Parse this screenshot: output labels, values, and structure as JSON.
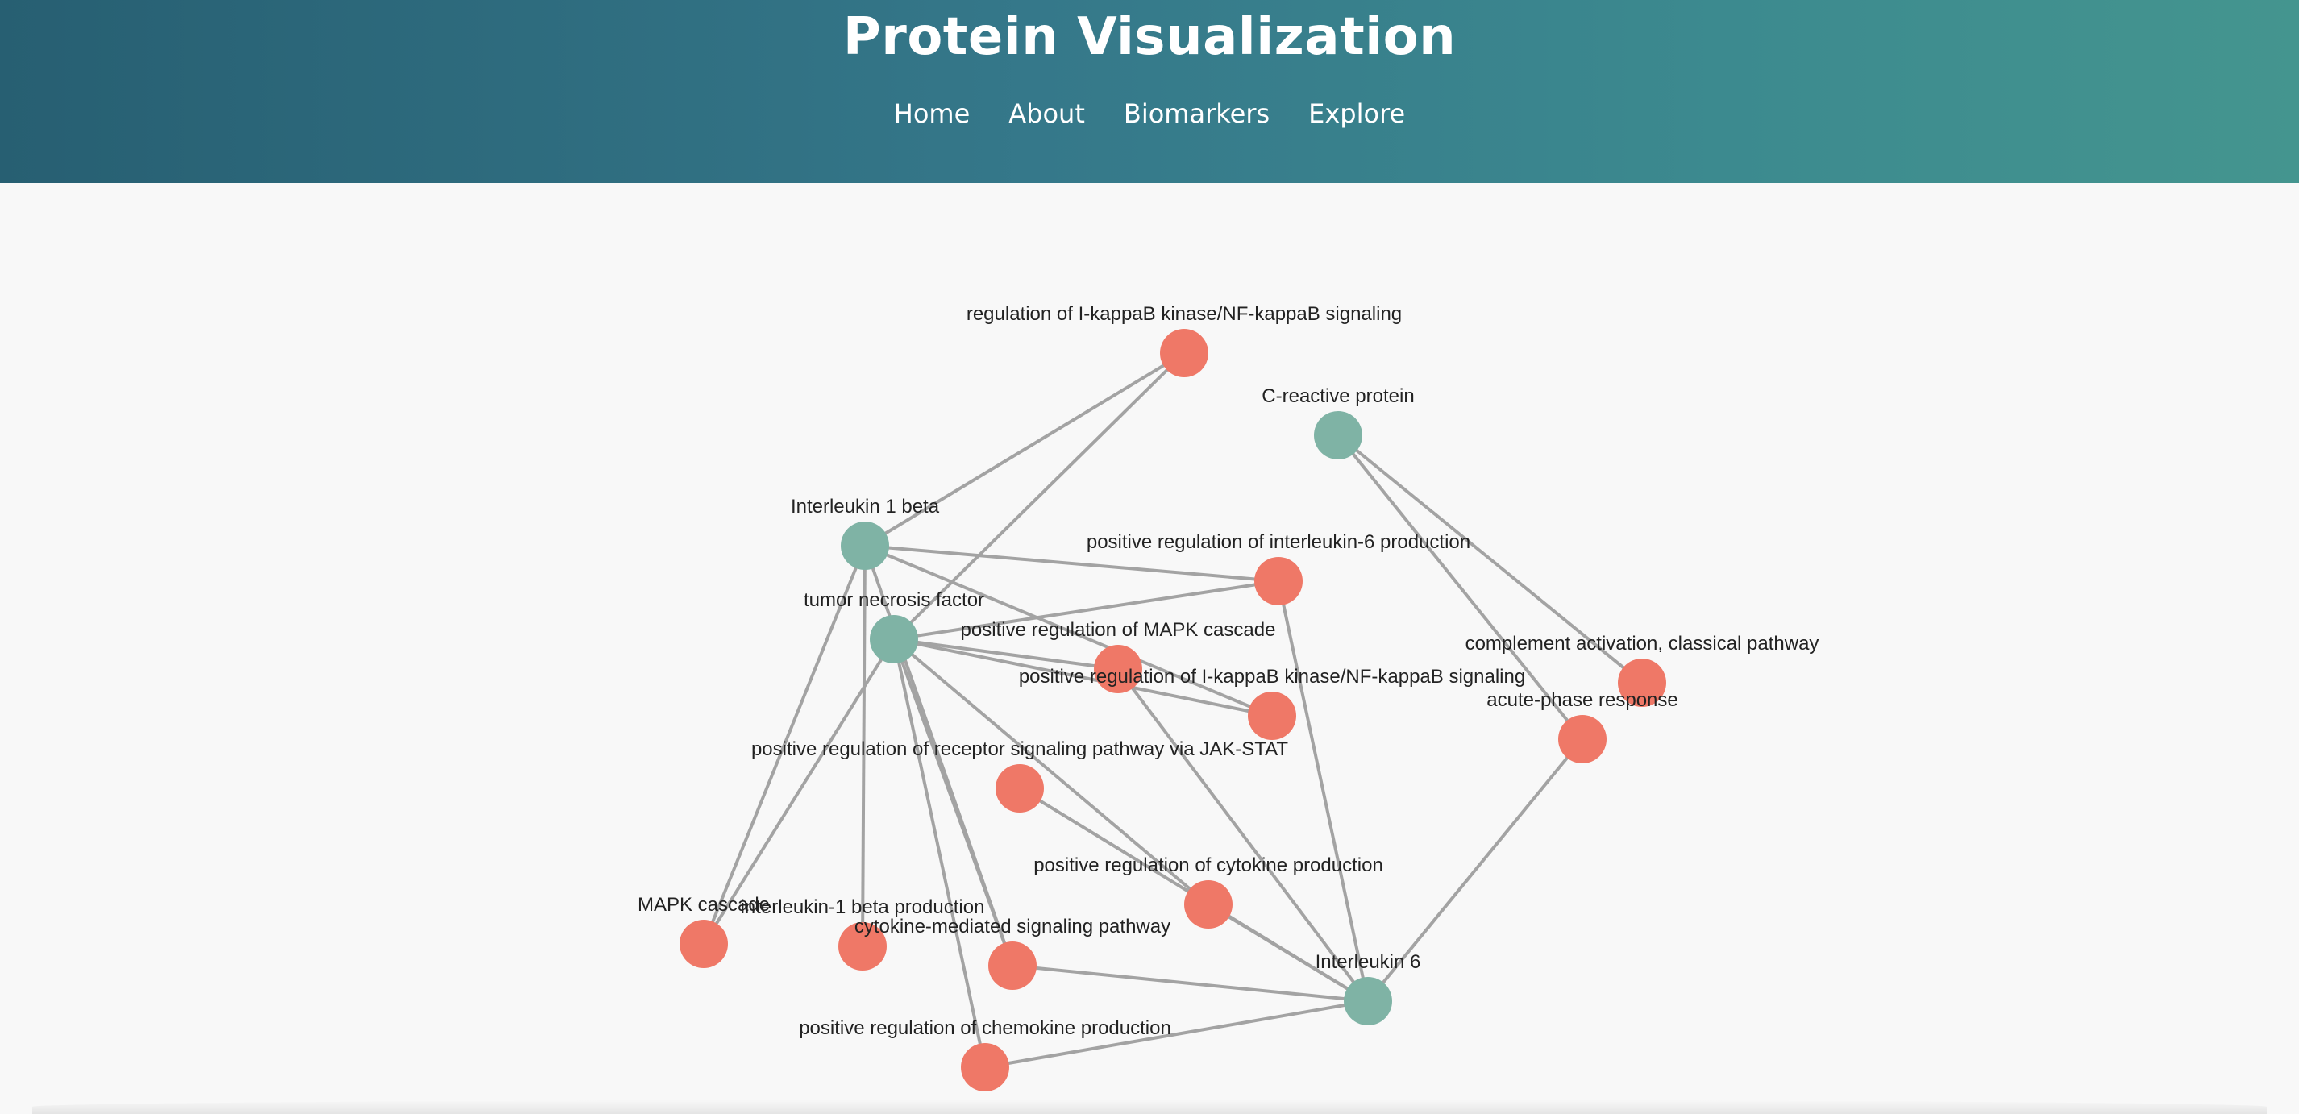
{
  "header": {
    "title": "Protein Visualization",
    "nav": [
      "Home",
      "About",
      "Biomarkers",
      "Explore"
    ]
  },
  "colors": {
    "header_gradient_start": "#275f72",
    "header_gradient_end": "#44958f",
    "protein_node": "#7fb3a5",
    "process_node": "#ef7867",
    "edge": "#a3a3a3",
    "background": "#f8f8f8"
  },
  "network": {
    "nodes": [
      {
        "id": "regulation-ikb",
        "label": "regulation of I-kappaB kinase/NF-kappaB signaling",
        "type": "process"
      },
      {
        "id": "crp",
        "label": "C-reactive protein",
        "type": "protein"
      },
      {
        "id": "il1b",
        "label": "Interleukin 1 beta",
        "type": "protein"
      },
      {
        "id": "pos-reg-il6",
        "label": "positive regulation of interleukin-6 production",
        "type": "process"
      },
      {
        "id": "tnf",
        "label": "tumor necrosis factor",
        "type": "protein"
      },
      {
        "id": "pos-reg-mapk",
        "label": "positive regulation of MAPK cascade",
        "type": "process"
      },
      {
        "id": "complement",
        "label": "complement activation, classical pathway",
        "type": "process"
      },
      {
        "id": "pos-reg-ikb",
        "label": "positive regulation of I-kappaB kinase/NF-kappaB signaling",
        "type": "process"
      },
      {
        "id": "acute-phase",
        "label": "acute-phase response",
        "type": "process"
      },
      {
        "id": "jak-stat",
        "label": "positive regulation of receptor signaling pathway via JAK-STAT",
        "type": "process"
      },
      {
        "id": "cytokine-prod",
        "label": "positive regulation of cytokine production",
        "type": "process"
      },
      {
        "id": "mapk",
        "label": "MAPK cascade",
        "type": "process"
      },
      {
        "id": "il1b-prod",
        "label": "interleukin-1 beta production",
        "type": "process"
      },
      {
        "id": "cytokine-signal",
        "label": "cytokine-mediated signaling pathway",
        "type": "process"
      },
      {
        "id": "il6",
        "label": "Interleukin 6",
        "type": "protein"
      },
      {
        "id": "chemokine",
        "label": "positive regulation of chemokine production",
        "type": "process"
      }
    ],
    "edges": [
      [
        "il1b",
        "regulation-ikb"
      ],
      [
        "tnf",
        "regulation-ikb"
      ],
      [
        "il1b",
        "pos-reg-il6"
      ],
      [
        "tnf",
        "pos-reg-il6"
      ],
      [
        "il6",
        "pos-reg-il6"
      ],
      [
        "il1b",
        "pos-reg-ikb"
      ],
      [
        "tnf",
        "pos-reg-ikb"
      ],
      [
        "tnf",
        "pos-reg-mapk"
      ],
      [
        "il6",
        "pos-reg-mapk"
      ],
      [
        "il1b",
        "mapk"
      ],
      [
        "tnf",
        "mapk"
      ],
      [
        "il1b",
        "il1b-prod"
      ],
      [
        "il1b",
        "cytokine-signal"
      ],
      [
        "tnf",
        "cytokine-signal"
      ],
      [
        "il6",
        "cytokine-signal"
      ],
      [
        "tnf",
        "chemokine"
      ],
      [
        "il6",
        "chemokine"
      ],
      [
        "tnf",
        "cytokine-prod"
      ],
      [
        "il6",
        "cytokine-prod"
      ],
      [
        "jak-stat",
        "il6"
      ],
      [
        "crp",
        "complement"
      ],
      [
        "crp",
        "acute-phase"
      ],
      [
        "il6",
        "acute-phase"
      ]
    ]
  }
}
